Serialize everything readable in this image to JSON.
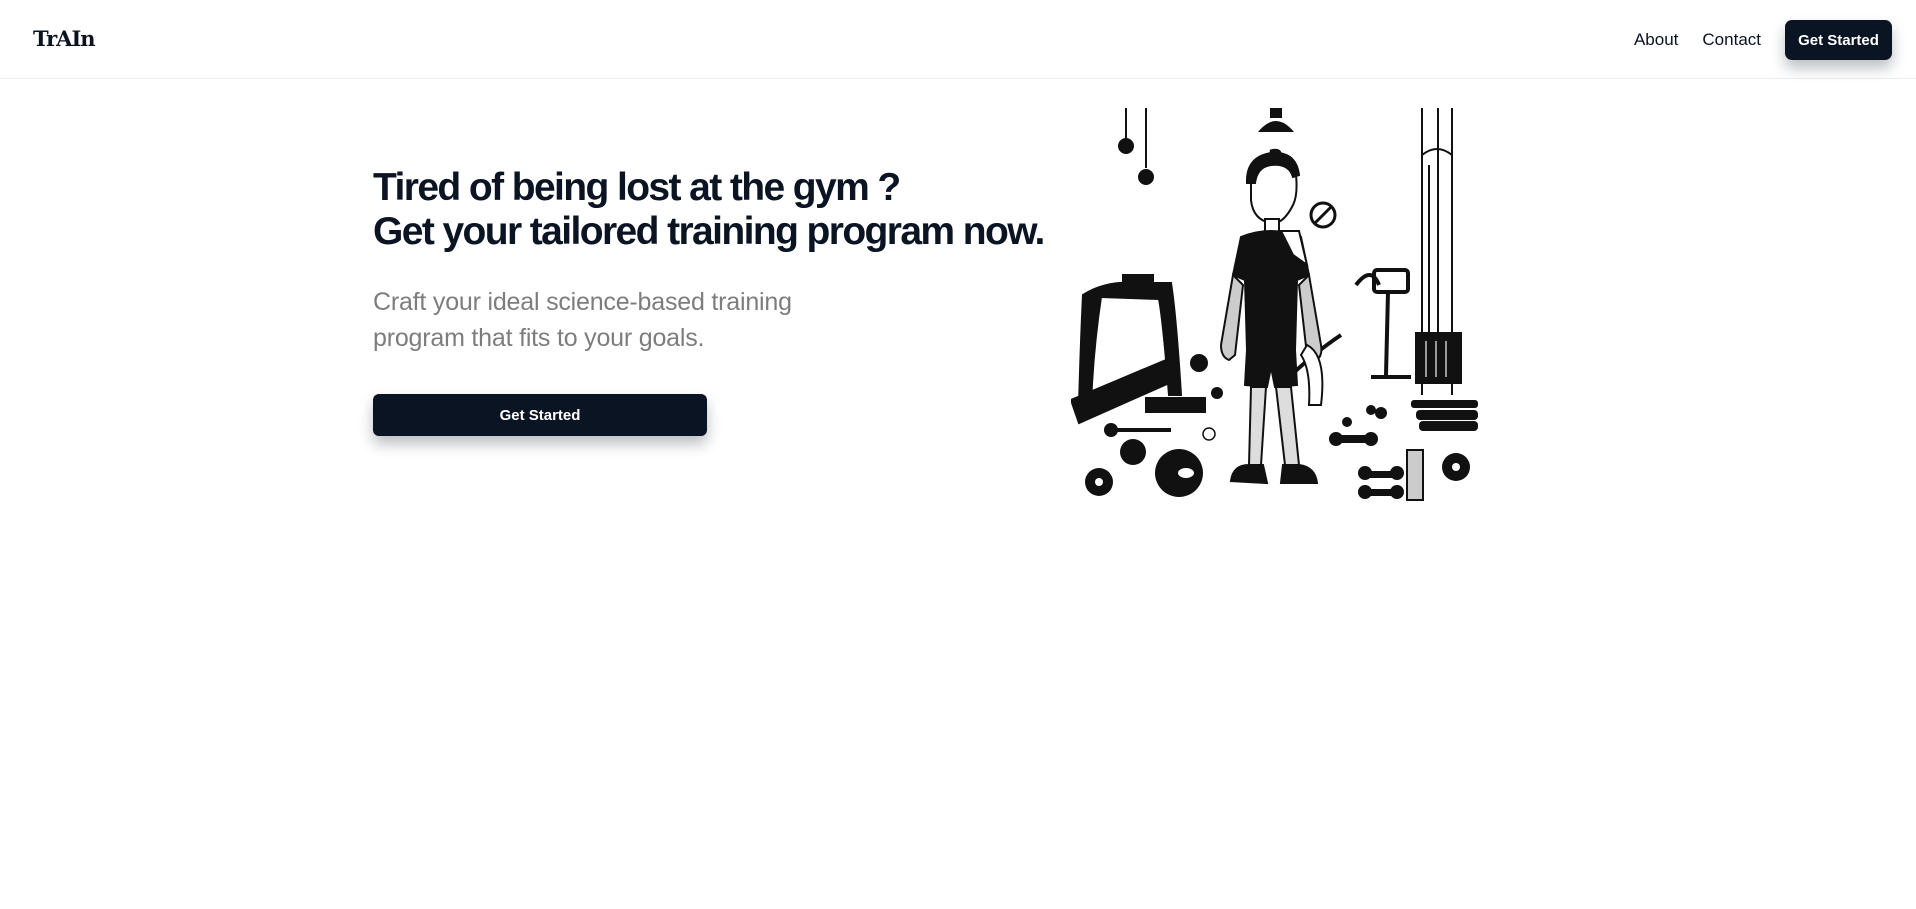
{
  "header": {
    "logo": "TrAIn",
    "nav": {
      "about": "About",
      "contact": "Contact"
    },
    "cta_label": "Get Started"
  },
  "hero": {
    "headline_line1": "Tired of being lost at the gym ?",
    "headline_line2": "Get your tailored training program now.",
    "subtitle": "Craft your ideal science-based training program that fits to your goals.",
    "cta_label": "Get Started"
  },
  "colors": {
    "primary": "#0b1422",
    "text": "#0b1220",
    "muted": "#7d7d7d"
  }
}
